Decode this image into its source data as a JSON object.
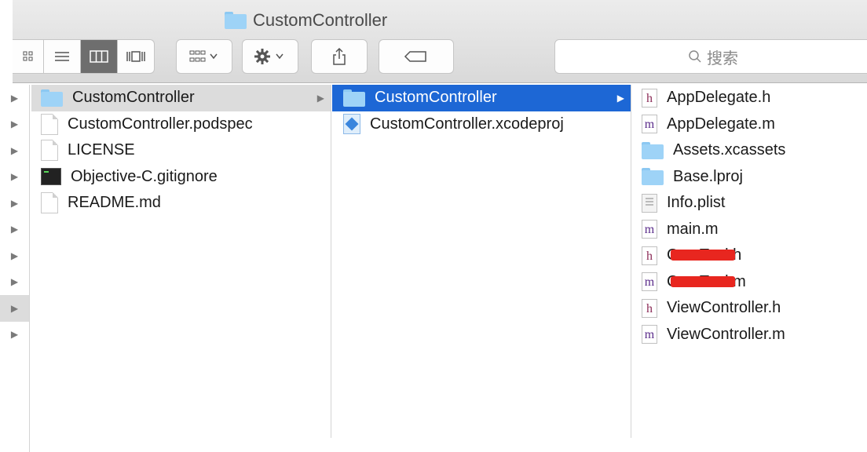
{
  "window": {
    "title": "CustomController"
  },
  "toolbar": {
    "search_placeholder": "搜索",
    "view_modes": [
      "icon-view",
      "list-view",
      "column-view",
      "cover-flow-view"
    ],
    "active_view": "column-view",
    "arrange_icon": "grid-arrange-icon",
    "action_icon": "gear-icon",
    "share_icon": "share-icon",
    "tag_icon": "tag-icon"
  },
  "colors": {
    "selection_blue": "#1d67d5",
    "selection_gray": "#dcdcdc",
    "folder": "#9ed3f7",
    "redaction": "#e8261f"
  },
  "columns": [
    {
      "items": [
        {
          "label": "CustomController",
          "icon": "folder-icon",
          "state": "selected-inactive",
          "has_arrow": true
        },
        {
          "label": "CustomController.podspec",
          "icon": "document-icon"
        },
        {
          "label": "LICENSE",
          "icon": "document-icon"
        },
        {
          "label": "Objective-C.gitignore",
          "icon": "terminal-icon"
        },
        {
          "label": "README.md",
          "icon": "document-icon"
        }
      ]
    },
    {
      "items": [
        {
          "label": "CustomController",
          "icon": "folder-icon",
          "state": "selected-active",
          "has_arrow": true
        },
        {
          "label": "CustomController.xcodeproj",
          "icon": "xcode-project-icon"
        }
      ]
    },
    {
      "items": [
        {
          "label": "AppDelegate.h",
          "icon": "h-source-icon",
          "letter": "h"
        },
        {
          "label": "AppDelegate.m",
          "icon": "m-source-icon",
          "letter": "m"
        },
        {
          "label": "Assets.xcassets",
          "icon": "folder-icon"
        },
        {
          "label": "Base.lproj",
          "icon": "folder-icon"
        },
        {
          "label": "Info.plist",
          "icon": "plist-icon"
        },
        {
          "label": "main.m",
          "icon": "m-source-icon",
          "letter": "m"
        },
        {
          "label": "Cou    Tool.h",
          "icon": "h-source-icon",
          "letter": "h",
          "redacted": true
        },
        {
          "label": "Cou    Tool.m",
          "icon": "m-source-icon",
          "letter": "m",
          "redacted": true
        },
        {
          "label": "ViewController.h",
          "icon": "h-source-icon",
          "letter": "h"
        },
        {
          "label": "ViewController.m",
          "icon": "m-source-icon",
          "letter": "m"
        }
      ]
    }
  ]
}
